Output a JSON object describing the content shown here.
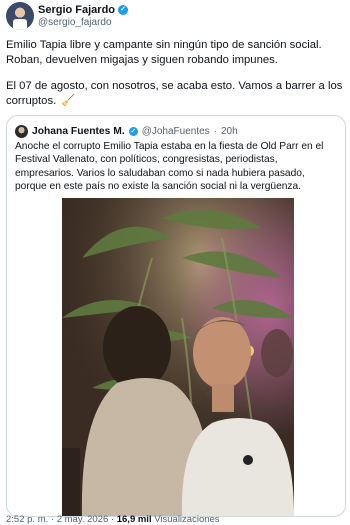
{
  "author": {
    "name": "Sergio Fajardo",
    "handle": "@sergio_fajardo",
    "verified_icon": "verified-badge-icon"
  },
  "tweet": {
    "paragraph1": "Emilio Tapia libre y campante sin ningún tipo de sanción social. Roban, devuelven migajas y siguen robando impunes.",
    "paragraph2": "El 07 de agosto, con nosotros, se acaba esto. Vamos a barrer a los corruptos.",
    "emoji": "🧹"
  },
  "quoted": {
    "name": "Johana Fuentes M.",
    "handle": "@JohaFuentes",
    "separator": "·",
    "time": "20h",
    "text": "Anoche el corrupto Emilio Tapia estaba en la fiesta de Old Parr en el Festival Vallenato, con políticos, congresistas, periodistas, empresarios. Varios lo saludaban como si nada hubiera pasado, porque en este país no existe la sanción social ni la vergüenza."
  },
  "footer": {
    "time": "2:52 p. m.",
    "separator": "·",
    "date": "2 may. 2026",
    "views": "16,9 mil",
    "views_label": "Visualizaciones"
  },
  "colors": {
    "accent": "#1d9bf0",
    "text": "#0f1419",
    "secondary": "#536471",
    "border": "#cfd9de"
  }
}
